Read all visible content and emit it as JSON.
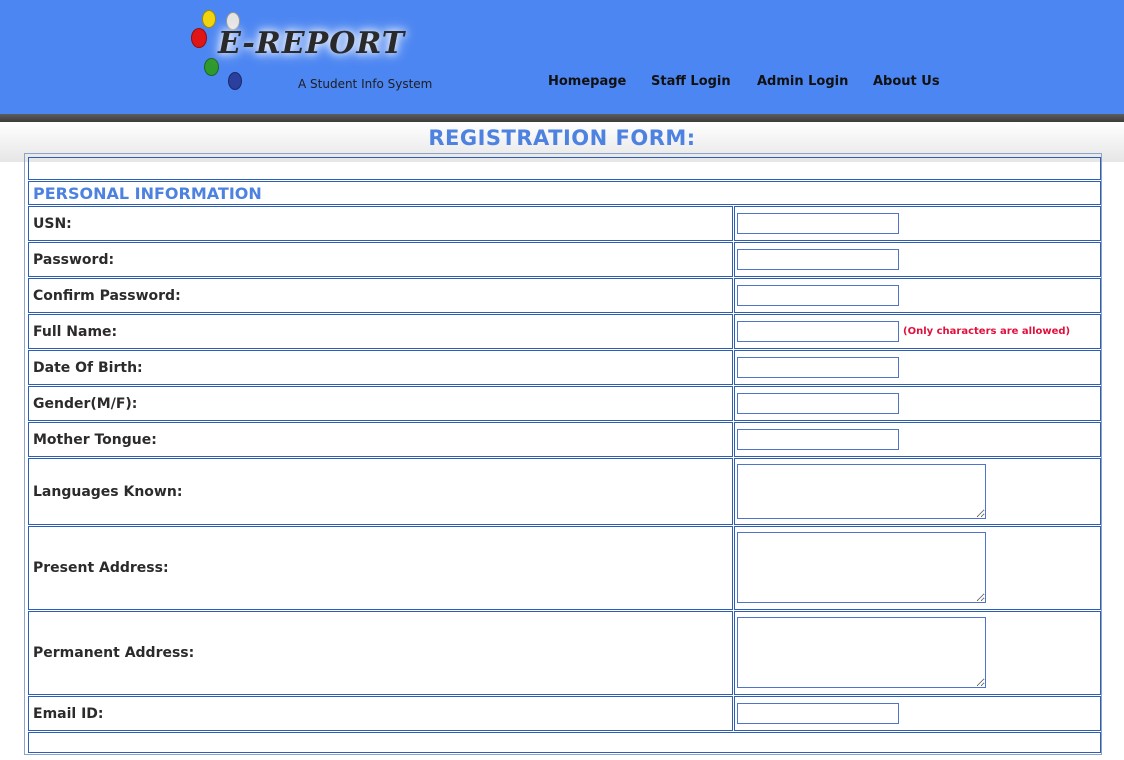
{
  "brand": {
    "logo_text": "E-REPORT",
    "tagline": "A Student Info System",
    "dot_colors": [
      "#f1d40e",
      "#d6d6d6",
      "#e01515",
      "#2e9a2e",
      "#2a3f9e"
    ]
  },
  "nav": {
    "items": [
      {
        "label": "Homepage"
      },
      {
        "label": "Staff Login"
      },
      {
        "label": "Admin Login"
      },
      {
        "label": "About Us"
      }
    ]
  },
  "form": {
    "title": "REGISTRATION FORM:",
    "section_personal": "PERSONAL INFORMATION",
    "fields": {
      "usn": {
        "label": "USN:",
        "value": ""
      },
      "password": {
        "label": "Password:",
        "value": ""
      },
      "confirm_password": {
        "label": "Confirm Password:",
        "value": ""
      },
      "full_name": {
        "label": "Full Name:",
        "value": "",
        "hint": "(Only characters are allowed)"
      },
      "dob": {
        "label": "Date Of Birth:",
        "value": ""
      },
      "gender": {
        "label": "Gender(M/F):",
        "value": ""
      },
      "mother_tongue": {
        "label": "Mother Tongue:",
        "value": ""
      },
      "languages_known": {
        "label": "Languages Known:",
        "value": ""
      },
      "present_address": {
        "label": "Present Address:",
        "value": ""
      },
      "permanent_address": {
        "label": "Permanent Address:",
        "value": ""
      },
      "email": {
        "label": "Email ID:",
        "value": ""
      }
    }
  },
  "colors": {
    "header_bg": "#4c86f2",
    "accent": "#4d82e0",
    "hint": "#e0103c",
    "border": "#2e5fb3"
  }
}
